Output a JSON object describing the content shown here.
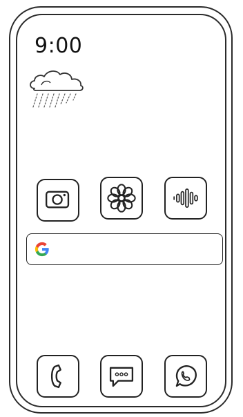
{
  "status": {
    "time": "9:00"
  },
  "widgets": {
    "weather_icon": "rain-cloud-icon"
  },
  "home_apps": [
    {
      "name": "camera",
      "icon": "camera-icon"
    },
    {
      "name": "flower",
      "icon": "flower-icon"
    },
    {
      "name": "voice",
      "icon": "sound-wave-icon"
    }
  ],
  "search": {
    "brand_icon": "google-g-icon",
    "value": "",
    "placeholder": ""
  },
  "dock": [
    {
      "name": "phone",
      "icon": "phone-icon"
    },
    {
      "name": "messages",
      "icon": "message-bubble-icon"
    },
    {
      "name": "whatsapp",
      "icon": "whatsapp-icon"
    }
  ],
  "colors": {
    "google_blue": "#4285F4",
    "google_red": "#EA4335",
    "google_yellow": "#FBBC05",
    "google_green": "#34A853"
  }
}
